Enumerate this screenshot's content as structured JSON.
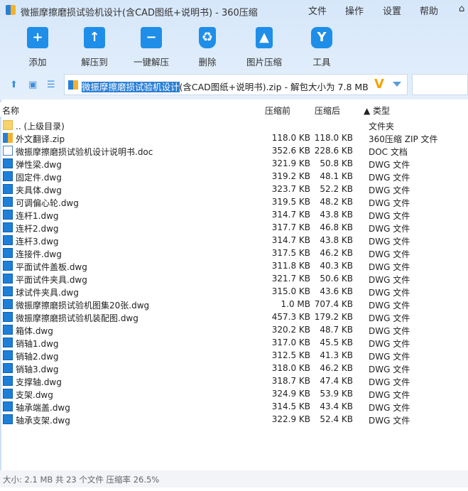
{
  "title": "微振摩擦磨损试验机设计(含CAD图纸+说明书) - 360压缩",
  "menu": [
    "文件",
    "操作",
    "设置",
    "帮助"
  ],
  "toolbar": [
    "添加",
    "解压到",
    "一键解压",
    "删除",
    "图片压缩",
    "工具"
  ],
  "address": {
    "selected": "微振摩擦磨损试验机设计",
    "rest": "(含CAD图纸+说明书).zip - 解包大小为 7.8 MB"
  },
  "columns": {
    "name": "名称",
    "before": "压缩前",
    "after": "压缩后",
    "type": "▲ 类型"
  },
  "files": [
    {
      "name": ".. (上级目录)",
      "before": "",
      "after": "",
      "type": "文件夹",
      "icon": "folder"
    },
    {
      "name": "外文翻译.zip",
      "before": "118.0 KB",
      "after": "118.0 KB",
      "type": "360压缩 ZIP 文件",
      "icon": "zip"
    },
    {
      "name": "微振摩擦磨损试验机设计说明书.doc",
      "before": "352.6 KB",
      "after": "228.6 KB",
      "type": "DOC 文档",
      "icon": "doc"
    },
    {
      "name": "弹性梁.dwg",
      "before": "321.9 KB",
      "after": "50.8 KB",
      "type": "DWG 文件",
      "icon": "dwg"
    },
    {
      "name": "固定件.dwg",
      "before": "319.2 KB",
      "after": "48.1 KB",
      "type": "DWG 文件",
      "icon": "dwg"
    },
    {
      "name": "夹具体.dwg",
      "before": "323.7 KB",
      "after": "52.2 KB",
      "type": "DWG 文件",
      "icon": "dwg"
    },
    {
      "name": "可调偏心轮.dwg",
      "before": "319.5 KB",
      "after": "48.2 KB",
      "type": "DWG 文件",
      "icon": "dwg"
    },
    {
      "name": "连杆1.dwg",
      "before": "314.7 KB",
      "after": "43.8 KB",
      "type": "DWG 文件",
      "icon": "dwg"
    },
    {
      "name": "连杆2.dwg",
      "before": "317.7 KB",
      "after": "46.8 KB",
      "type": "DWG 文件",
      "icon": "dwg"
    },
    {
      "name": "连杆3.dwg",
      "before": "314.7 KB",
      "after": "43.8 KB",
      "type": "DWG 文件",
      "icon": "dwg"
    },
    {
      "name": "连接件.dwg",
      "before": "317.5 KB",
      "after": "46.2 KB",
      "type": "DWG 文件",
      "icon": "dwg"
    },
    {
      "name": "平面试件盖板.dwg",
      "before": "311.8 KB",
      "after": "40.3 KB",
      "type": "DWG 文件",
      "icon": "dwg"
    },
    {
      "name": "平面试件夹具.dwg",
      "before": "321.7 KB",
      "after": "50.6 KB",
      "type": "DWG 文件",
      "icon": "dwg"
    },
    {
      "name": "球试件夹具.dwg",
      "before": "315.0 KB",
      "after": "43.6 KB",
      "type": "DWG 文件",
      "icon": "dwg"
    },
    {
      "name": "微振摩擦磨损试验机图集20张.dwg",
      "before": "1.0 MB",
      "after": "707.4 KB",
      "type": "DWG 文件",
      "icon": "dwg"
    },
    {
      "name": "微振摩擦磨损试验机装配图.dwg",
      "before": "457.3 KB",
      "after": "179.2 KB",
      "type": "DWG 文件",
      "icon": "dwg"
    },
    {
      "name": "箱体.dwg",
      "before": "320.2 KB",
      "after": "48.7 KB",
      "type": "DWG 文件",
      "icon": "dwg"
    },
    {
      "name": "销轴1.dwg",
      "before": "317.0 KB",
      "after": "45.5 KB",
      "type": "DWG 文件",
      "icon": "dwg"
    },
    {
      "name": "销轴2.dwg",
      "before": "312.5 KB",
      "after": "41.3 KB",
      "type": "DWG 文件",
      "icon": "dwg"
    },
    {
      "name": "销轴3.dwg",
      "before": "318.0 KB",
      "after": "46.2 KB",
      "type": "DWG 文件",
      "icon": "dwg"
    },
    {
      "name": "支撑轴.dwg",
      "before": "318.7 KB",
      "after": "47.4 KB",
      "type": "DWG 文件",
      "icon": "dwg"
    },
    {
      "name": "支架.dwg",
      "before": "324.9 KB",
      "after": "53.9 KB",
      "type": "DWG 文件",
      "icon": "dwg"
    },
    {
      "name": "轴承端盖.dwg",
      "before": "314.5 KB",
      "after": "43.4 KB",
      "type": "DWG 文件",
      "icon": "dwg"
    },
    {
      "name": "轴承支架.dwg",
      "before": "322.9 KB",
      "after": "52.4 KB",
      "type": "DWG 文件",
      "icon": "dwg"
    }
  ],
  "status": "大小: 2.1 MB 共 23 个文件 压缩率 26.5%"
}
